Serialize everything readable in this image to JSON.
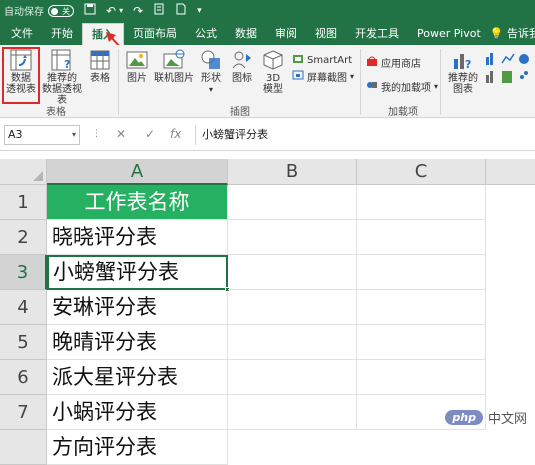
{
  "titlebar": {
    "autosave_label": "自动保存",
    "autosave_state": "关"
  },
  "tabs": [
    "文件",
    "开始",
    "插入",
    "页面布局",
    "公式",
    "数据",
    "审阅",
    "视图",
    "开发工具",
    "Power Pivot"
  ],
  "active_tab": "插入",
  "tell_me": "告诉我你想要",
  "ribbon": {
    "pivot_table": "数据\n透视表",
    "recommended_pivot": "推荐的\n数据透视表",
    "table": "表格",
    "group_tables": "表格",
    "picture": "图片",
    "online_picture": "联机图片",
    "shapes": "形状",
    "icons": "图标",
    "model_3d": "3D\n模型",
    "smartart": "SmartArt",
    "screenshot": "屏幕截图",
    "group_illustrations": "插图",
    "store": "应用商店",
    "my_addins": "我的加载项",
    "group_addins": "加载项",
    "recommended_charts": "推荐的\n图表"
  },
  "formula_bar": {
    "name_box": "A3",
    "content": "小螃蟹评分表"
  },
  "sheet": {
    "columns": [
      "A",
      "B",
      "C"
    ],
    "rows": [
      "1",
      "2",
      "3",
      "4",
      "5",
      "6",
      "7"
    ],
    "cells_a": [
      "工作表名称",
      "晓晓评分表",
      "小螃蟹评分表",
      "安琳评分表",
      "晚晴评分表",
      "派大星评分表",
      "小蜗评分表",
      "方向评分表"
    ],
    "selected_cell": "A3"
  },
  "watermark": {
    "brand": "php",
    "text": "中文网"
  },
  "colors": {
    "accent": "#217346",
    "header_fill": "#26b061",
    "highlight_box": "#e0292b"
  }
}
